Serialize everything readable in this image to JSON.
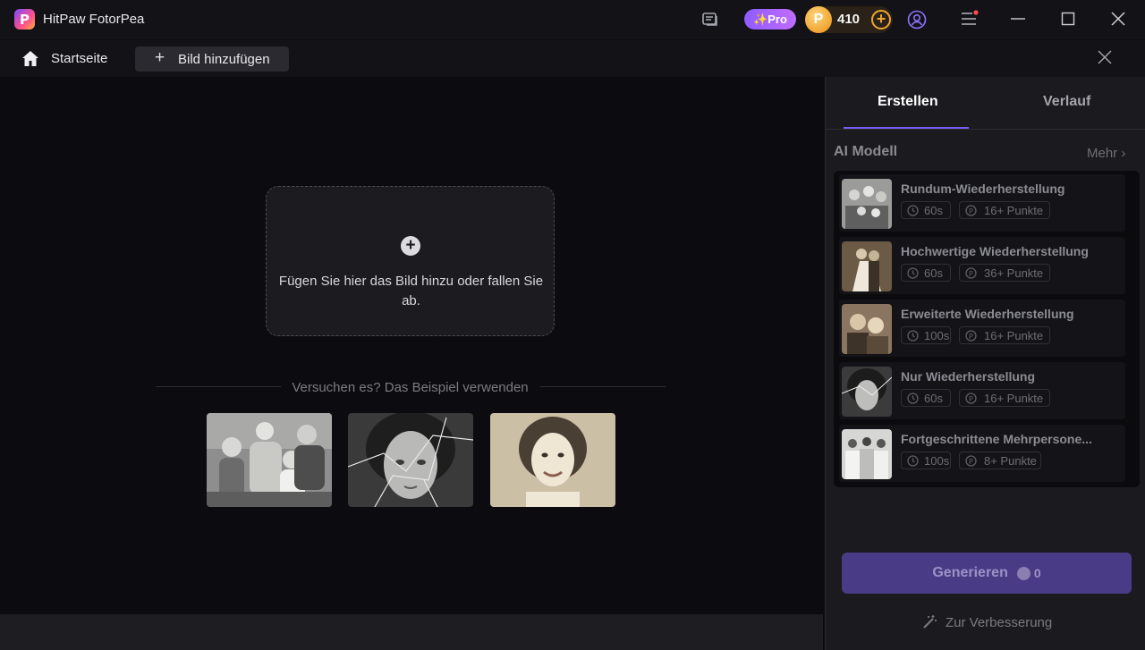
{
  "window": {
    "title": "HitPaw FotorPea",
    "logo_letter": "P"
  },
  "titlebar": {
    "pro_label": "✨Pro",
    "points": "410",
    "icons": [
      "feedback-icon",
      "coin-icon",
      "add-coin-icon",
      "user-icon",
      "menu-icon",
      "minimize-icon",
      "maximize-icon",
      "close-icon"
    ]
  },
  "nav": {
    "home_label": "Startseite",
    "add_image_label": "Bild hinzufügen"
  },
  "dropzone": {
    "text": "Fügen Sie hier das Bild hinzu oder fallen Sie ab."
  },
  "examples": {
    "label": "Versuchen es? Das Beispiel verwenden"
  },
  "sidebar": {
    "tabs": [
      {
        "label": "Erstellen",
        "active": true
      },
      {
        "label": "Verlauf",
        "active": false
      }
    ],
    "ai_title": "AI Modell",
    "more_label": "Mehr",
    "models": [
      {
        "name": "Rundum-Wiederherstellung",
        "time": "60s",
        "points": "16+ Punkte"
      },
      {
        "name": "Hochwertige Wiederherstellung",
        "time": "60s",
        "points": "36+ Punkte"
      },
      {
        "name": "Erweiterte Wiederherstellung",
        "time": "100s",
        "points": "16+ Punkte"
      },
      {
        "name": "Nur Wiederherstellung",
        "time": "60s",
        "points": "16+ Punkte"
      },
      {
        "name": "Fortgeschrittene Mehrpersone...",
        "time": "100s",
        "points": "8+ Punkte"
      }
    ],
    "generate_label": "Generieren",
    "generate_cost": "0",
    "improve_label": "Zur Verbesserung"
  },
  "colors": {
    "accent": "#7a5cff",
    "background": "#0c0b0f",
    "panel": "#1b1b1f",
    "coin": "#f0a531"
  }
}
